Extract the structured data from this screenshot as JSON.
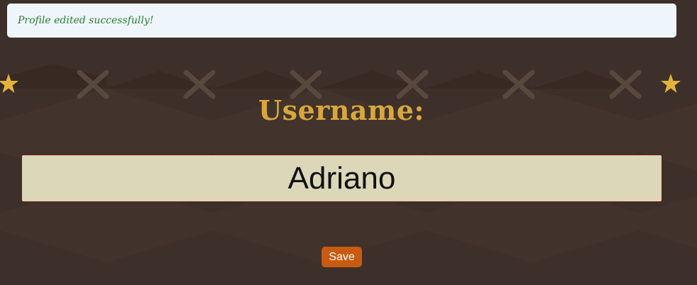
{
  "alert": {
    "message": "Profile edited successfully!"
  },
  "form": {
    "label": "Username:",
    "username_value": "Adriano",
    "save_label": "Save"
  },
  "colors": {
    "background": "#3d2f29",
    "alert_bg": "#eef6fc",
    "alert_text": "#2a7d2e",
    "label": "#d8a73c",
    "input_bg": "#dcd7b8",
    "input_border": "#7d1d12",
    "button": "#c95a12",
    "star": "#e2b33b"
  },
  "decorations": {
    "icons": [
      "star-icon",
      "crossed-swords-icon"
    ]
  }
}
